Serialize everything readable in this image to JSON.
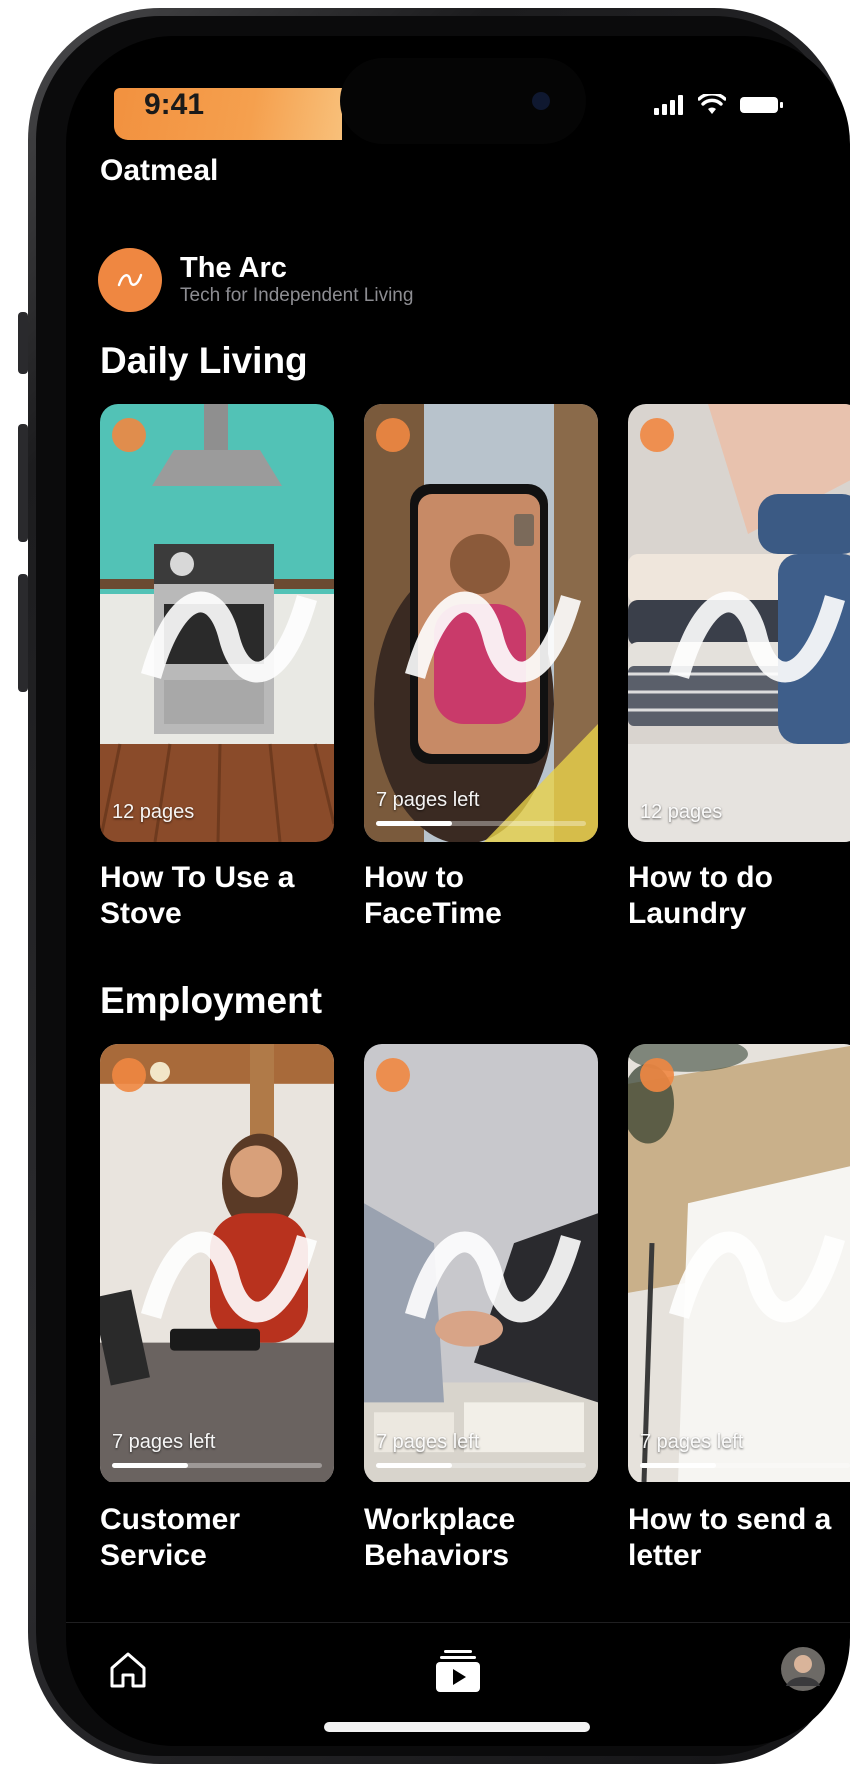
{
  "status_bar": {
    "time": "9:41",
    "icons": [
      "signal-icon",
      "wifi-icon",
      "battery-icon"
    ]
  },
  "header": {
    "app_title": "Oatmeal",
    "org_name": "The Arc",
    "org_tagline": "Tech for Independent Living"
  },
  "colors": {
    "accent": "#ef8741",
    "background": "#000000",
    "text": "#ffffff",
    "muted": "#8d8d92"
  },
  "sections": [
    {
      "title": "Daily Living",
      "cards": [
        {
          "title": "How To Use a Stove",
          "pages_text": "12 pages",
          "progress": null,
          "image": "kitchen-stove"
        },
        {
          "title": "How to FaceTime",
          "pages_text": "7 pages left",
          "progress": 0.36,
          "image": "phone-facetime"
        },
        {
          "title": "How to do Laundry",
          "pages_text": "12 pages",
          "progress": null,
          "image": "folded-laundry"
        }
      ]
    },
    {
      "title": "Employment",
      "cards": [
        {
          "title": "Customer Service",
          "pages_text": "7 pages left",
          "progress": 0.36,
          "image": "cashier-woman"
        },
        {
          "title": "Workplace Behaviors",
          "pages_text": "7 pages left",
          "progress": 0.36,
          "image": "handshake"
        },
        {
          "title": "How to send a letter",
          "pages_text": "7 pages left",
          "progress": 0.36,
          "image": "envelope-letter"
        }
      ]
    }
  ],
  "tab_bar": {
    "tabs": [
      "home-icon",
      "lessons-icon",
      "profile-avatar"
    ],
    "active": "lessons-icon"
  }
}
